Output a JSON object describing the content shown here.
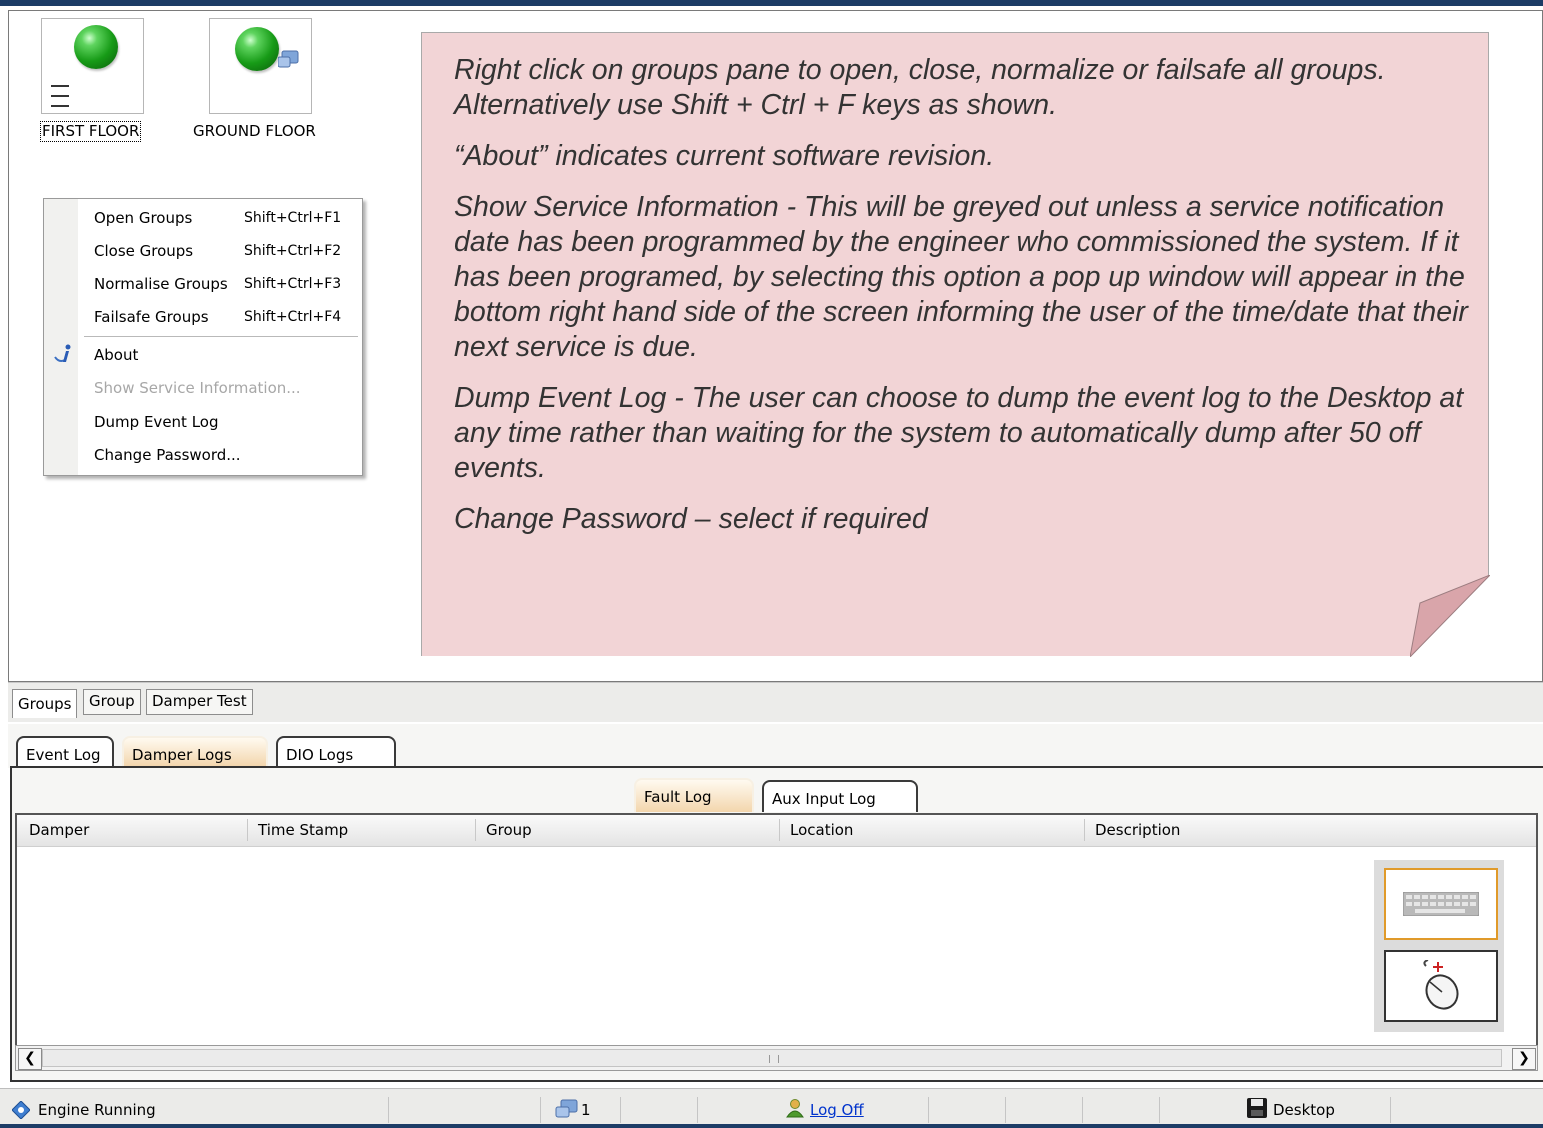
{
  "groups": [
    {
      "label": "FIRST FLOOR",
      "status": "green"
    },
    {
      "label": "GROUND FLOOR",
      "status": "green"
    }
  ],
  "context_menu": {
    "items": [
      {
        "label": "Open Groups",
        "shortcut": "Shift+Ctrl+F1",
        "mnemonic": "O"
      },
      {
        "label": "Close Groups",
        "shortcut": "Shift+Ctrl+F2",
        "mnemonic": "C"
      },
      {
        "label": "Normalise Groups",
        "shortcut": "Shift+Ctrl+F3",
        "mnemonic": "N"
      },
      {
        "label": "Failsafe Groups",
        "shortcut": "Shift+Ctrl+F4",
        "mnemonic": "F"
      },
      {
        "label": "About",
        "icon": "info-icon",
        "mnemonic": "A"
      },
      {
        "label": "Show Service Information...",
        "disabled": true,
        "mnemonic": "S"
      },
      {
        "label": "Dump Event Log",
        "mnemonic": "D"
      },
      {
        "label": "Change Password...",
        "mnemonic": "h"
      }
    ]
  },
  "note": {
    "paragraphs": [
      "Right click on groups pane to open, close, normalize or failsafe all groups. Alternatively use Shift + Ctrl + F keys as shown.",
      "“About” indicates current software revision.",
      "Show Service Information - This will be greyed out unless a service notification date has been programmed by the engineer who commissioned the system.   If it has been programed, by selecting this option a pop up window will appear in the bottom right hand side of the screen informing the user of the time/date that their next service is due.",
      "Dump Event Log - The user can choose to dump the event log to the Desktop at any time rather than waiting for the system to automatically dump after 50 off events.",
      "Change Password – select if required"
    ]
  },
  "view_tabs": [
    "Groups",
    "Group",
    "Damper Test"
  ],
  "log_tabs": [
    "Event Log",
    "Damper Logs",
    "DIO Logs"
  ],
  "sub_tabs": [
    "Fault Log",
    "Aux Input Log"
  ],
  "table": {
    "columns": [
      "Damper",
      "Time Stamp",
      "Group",
      "Location",
      "Description"
    ]
  },
  "status": {
    "engine": "Engine Running",
    "connections": "1",
    "logoff": "Log Off",
    "desktop": "Desktop"
  },
  "colors": {
    "note_bg": "#f2d4d6",
    "title_band": "#1d3c66",
    "active_tab": "#f3d6ad"
  }
}
